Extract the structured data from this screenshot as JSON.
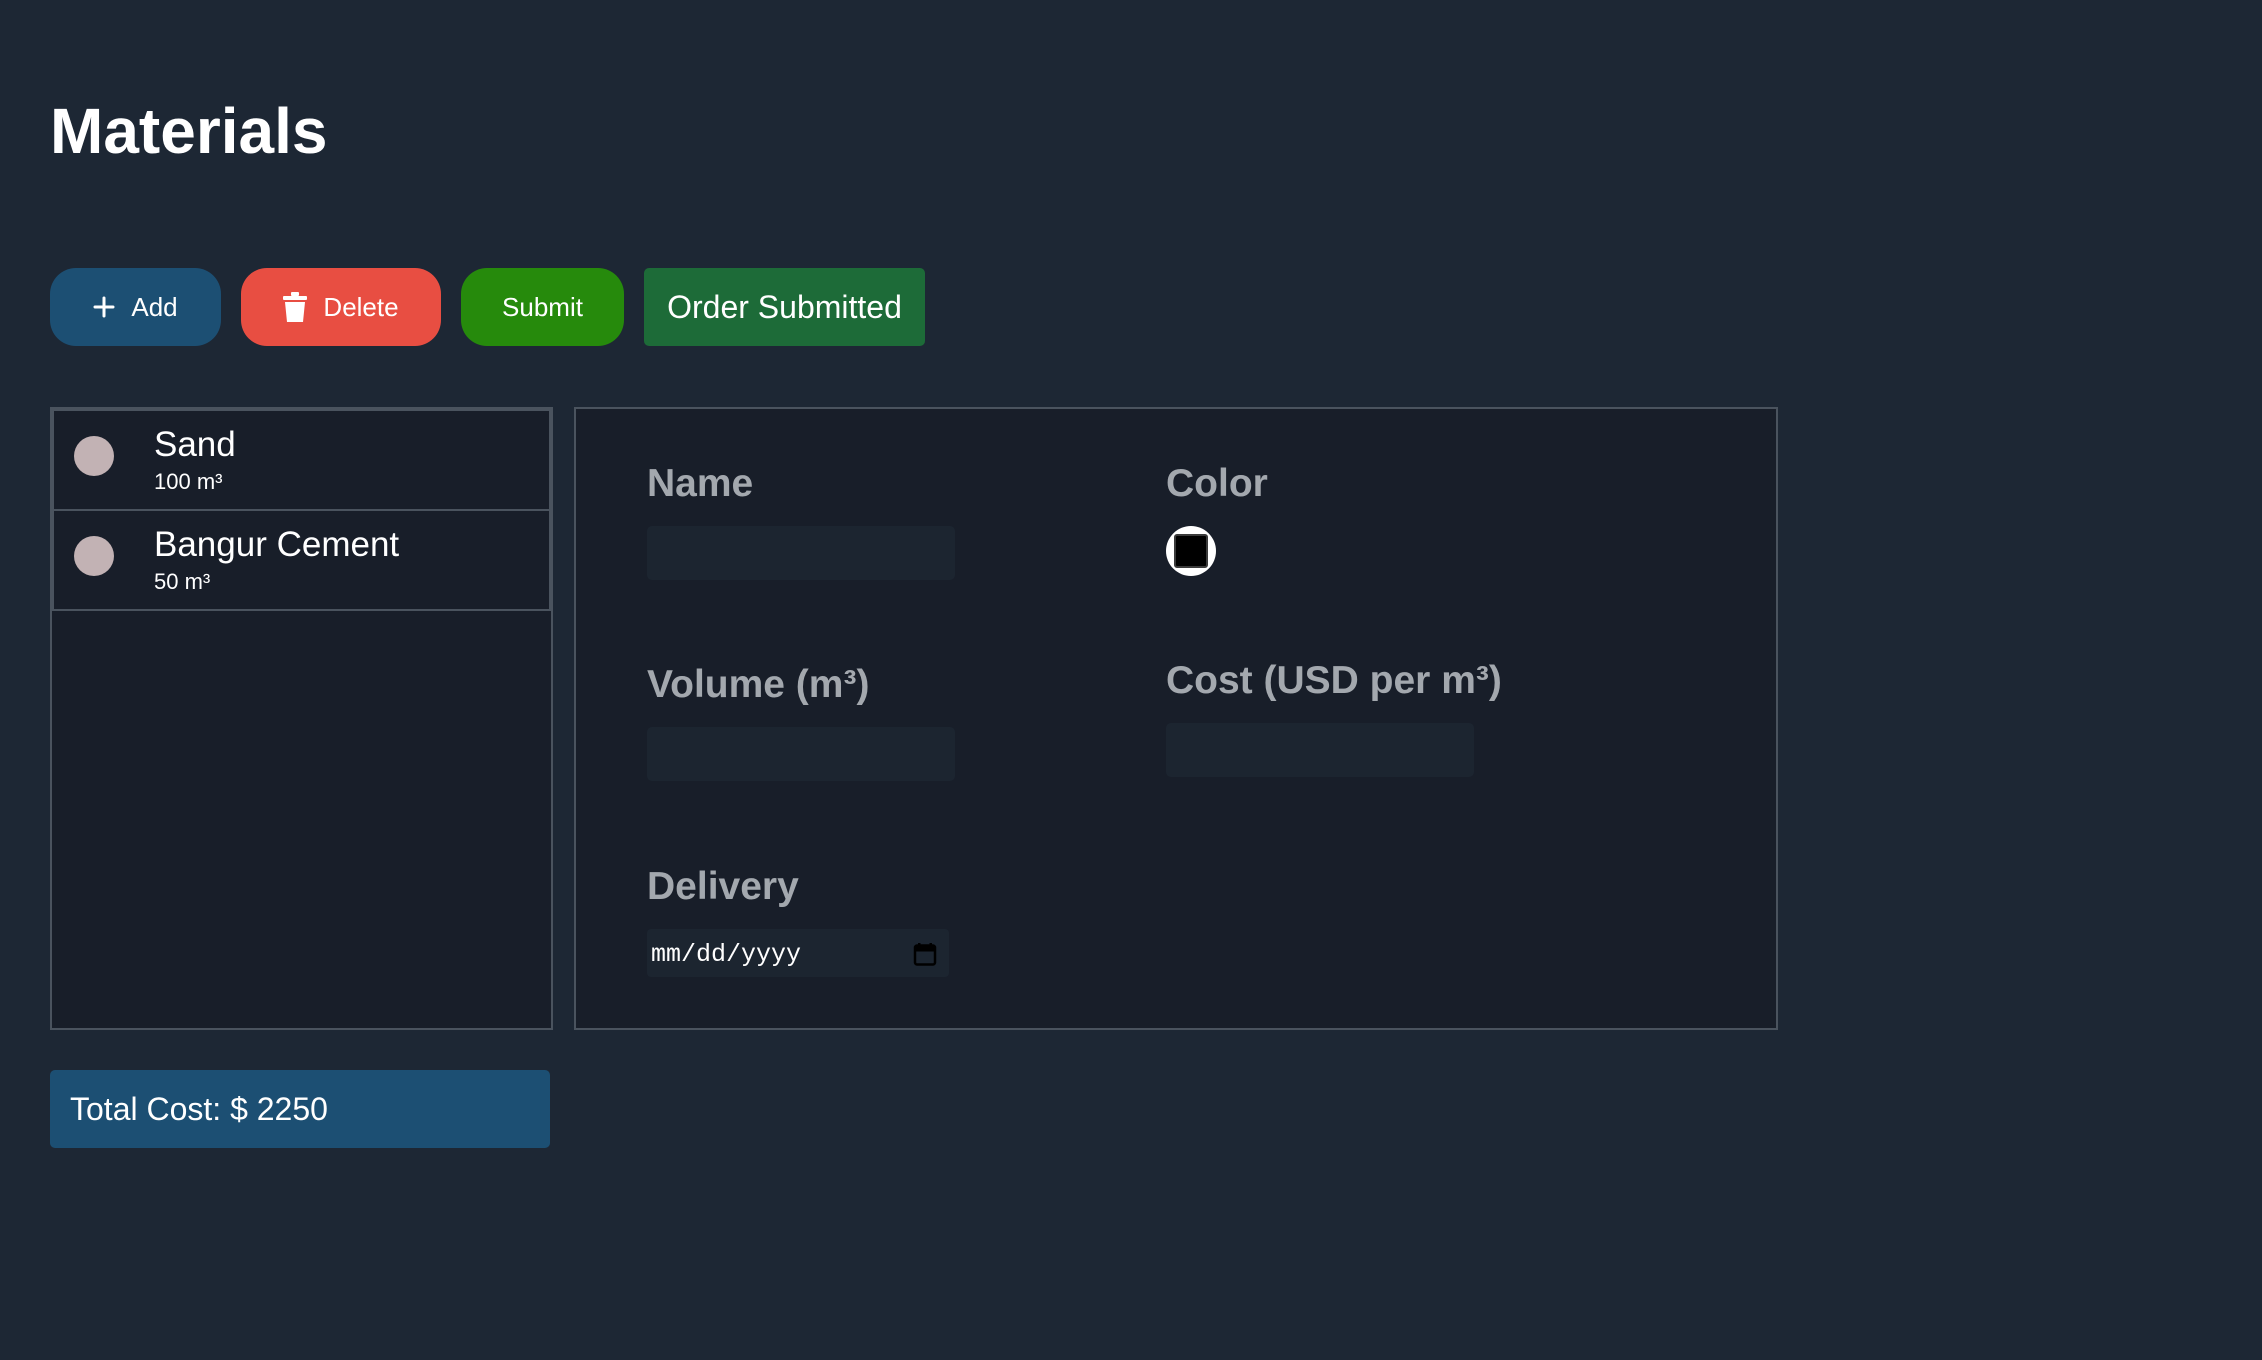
{
  "page": {
    "title": "Materials"
  },
  "toolbar": {
    "add_label": "Add",
    "add_icon": "plus-icon",
    "delete_label": "Delete",
    "delete_icon": "trash-icon",
    "submit_label": "Submit",
    "status_label": "Order Submitted"
  },
  "materials": {
    "items": [
      {
        "name": "Sand",
        "volume": "100 m³",
        "color": "#c2b2b4"
      },
      {
        "name": "Bangur Cement",
        "volume": "50 m³",
        "color": "#c2b2b4"
      }
    ]
  },
  "form": {
    "name_label": "Name",
    "name_value": "",
    "color_label": "Color",
    "color_value": "#000000",
    "volume_label": "Volume (m³)",
    "volume_value": "",
    "cost_label": "Cost (USD per m³)",
    "cost_value": "",
    "delivery_label": "Delivery",
    "delivery_placeholder": "mm/dd/yyyy",
    "calendar_icon": "calendar-icon"
  },
  "total": {
    "label": "Total Cost:",
    "currency": "$",
    "value": "2250"
  },
  "colors": {
    "background": "#1d2734",
    "panel": "#181e29",
    "add_button": "#1c4f73",
    "delete_button": "#e84e42",
    "submit_button": "#268a0c",
    "status_badge": "#1d6b38",
    "total_bar": "#1c4f73"
  }
}
